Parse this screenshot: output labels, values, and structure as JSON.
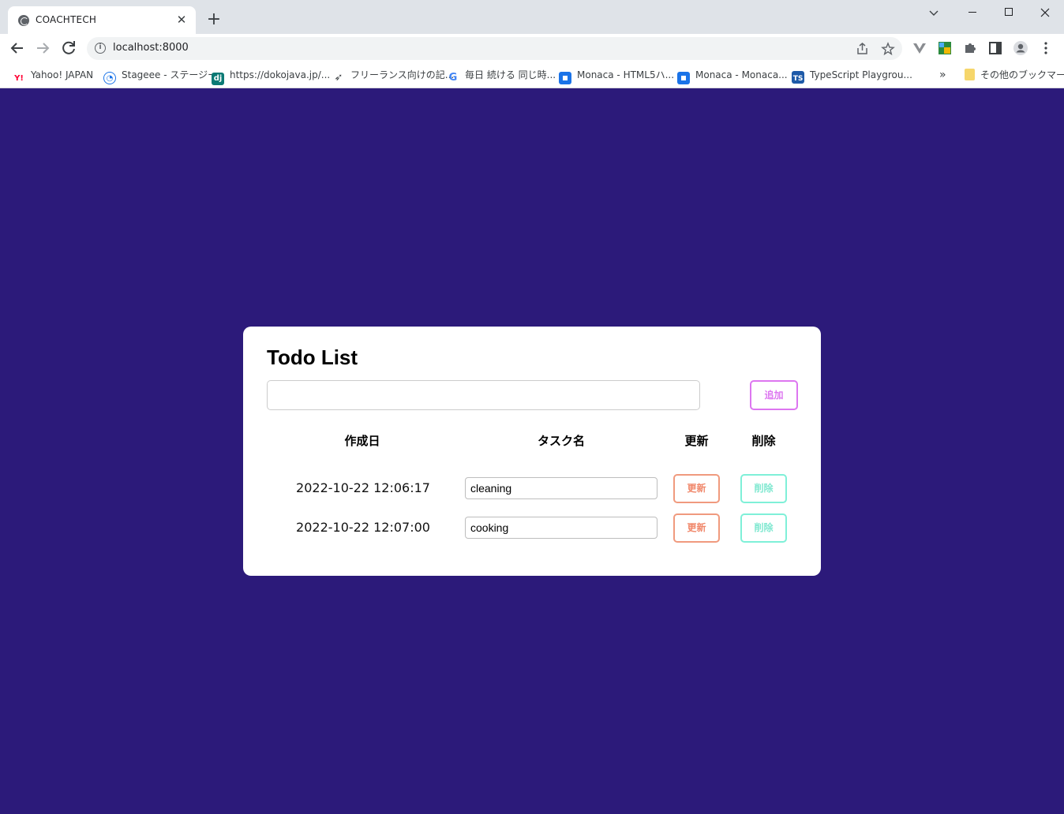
{
  "browser": {
    "tab_title": "COACHTECH",
    "tab_close": "✕",
    "new_tab": "+",
    "url": "localhost:8000",
    "bookmarks": [
      {
        "label": "Yahoo! JAPAN",
        "icon": "yahoo-icon"
      },
      {
        "label": "Stageee - ステージー",
        "icon": "stageee-icon"
      },
      {
        "label": "https://dokojava.jp/...",
        "icon": "dokojava-icon"
      },
      {
        "label": "フリーランス向けの記...",
        "icon": "rocket-icon"
      },
      {
        "label": "毎日 続ける 同じ時...",
        "icon": "google-icon"
      },
      {
        "label": "Monaca - HTML5ハ...",
        "icon": "monaca-icon"
      },
      {
        "label": "Monaca - Monaca...",
        "icon": "monaca-icon"
      },
      {
        "label": "TypeScript Playgrou...",
        "icon": "typescript-icon"
      }
    ],
    "overflow": "»",
    "other_bookmarks": "その他のブックマーク"
  },
  "todo": {
    "title": "Todo List",
    "new_task_value": "",
    "add_label": "追加",
    "headers": {
      "created": "作成日",
      "task": "タスク名",
      "update": "更新",
      "delete": "削除"
    },
    "rows": [
      {
        "created": "2022-10-22 12:06:17",
        "task": "cleaning",
        "update": "更新",
        "delete": "削除"
      },
      {
        "created": "2022-10-22 12:07:00",
        "task": "cooking",
        "update": "更新",
        "delete": "削除"
      }
    ]
  },
  "colors": {
    "page_background": "#2c1a7a",
    "add_button": "#dd76f0",
    "update_button": "#f09a7e",
    "delete_button": "#7ff0d8"
  }
}
